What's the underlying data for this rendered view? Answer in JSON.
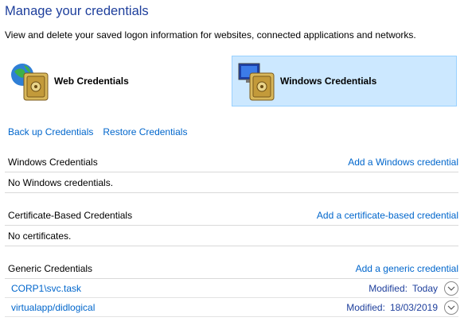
{
  "header": {
    "title": "Manage your credentials",
    "subtitle": "View and delete your saved logon information for websites, connected applications and networks."
  },
  "tiles": {
    "web": {
      "label": "Web Credentials",
      "icon": "web-credentials-icon"
    },
    "windows": {
      "label": "Windows Credentials",
      "icon": "windows-credentials-icon",
      "selected": true
    }
  },
  "actions": {
    "backup": "Back up Credentials",
    "restore": "Restore Credentials"
  },
  "sections": {
    "windows": {
      "title": "Windows Credentials",
      "add": "Add a Windows credential",
      "empty": "No Windows credentials."
    },
    "certificate": {
      "title": "Certificate-Based Credentials",
      "add": "Add a certificate-based credential",
      "empty": "No certificates."
    },
    "generic": {
      "title": "Generic Credentials",
      "add": "Add a generic credential",
      "items": [
        {
          "name": "CORP1\\svc.task",
          "modified_label": "Modified:",
          "modified": "Today"
        },
        {
          "name": "virtualapp/didlogical",
          "modified_label": "Modified:",
          "modified": "18/03/2019"
        }
      ]
    }
  },
  "colors": {
    "title": "#1e3f9c",
    "link": "#0066cc",
    "selected_tile": "#cce8ff"
  }
}
